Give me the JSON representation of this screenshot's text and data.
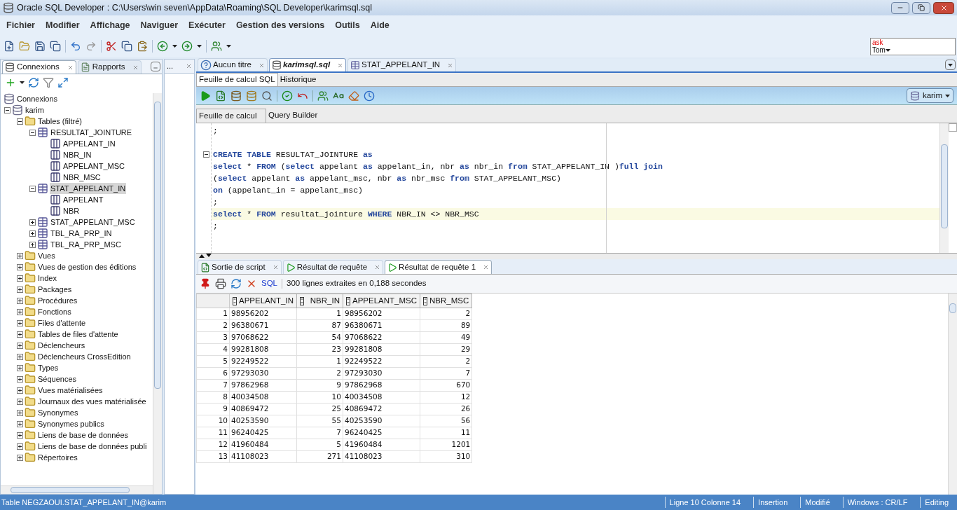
{
  "window": {
    "title": "Oracle SQL Developer : C:\\Users\\win seven\\AppData\\Roaming\\SQL Developer\\karimsql.sql"
  },
  "menu": [
    "Fichier",
    "Modifier",
    "Affichage",
    "Naviguer",
    "Exécuter",
    "Gestion des versions",
    "Outils",
    "Aide"
  ],
  "ask_tom": {
    "line_1": "ask",
    "line_2": "Tom"
  },
  "connections_panel": {
    "tabs": [
      {
        "label": "Connexions",
        "selected": true
      },
      {
        "label": "Rapports",
        "selected": false
      }
    ],
    "tree": [
      {
        "label": "Connexions",
        "kind": "connections",
        "selected": false,
        "children": [
          {
            "label": "karim",
            "kind": "connection",
            "expanded": true,
            "selected": false,
            "children": [
              {
                "label": "Tables (filtré)",
                "kind": "folder",
                "expanded": true,
                "selected": false,
                "children": [
                  {
                    "label": "RESULTAT_JOINTURE",
                    "kind": "table",
                    "expanded": true,
                    "selected": false,
                    "children": [
                      {
                        "label": "APPELANT_IN",
                        "kind": "column",
                        "selected": false
                      },
                      {
                        "label": "NBR_IN",
                        "kind": "column",
                        "selected": false
                      },
                      {
                        "label": "APPELANT_MSC",
                        "kind": "column",
                        "selected": false
                      },
                      {
                        "label": "NBR_MSC",
                        "kind": "column",
                        "selected": false
                      }
                    ]
                  },
                  {
                    "label": "STAT_APPELANT_IN",
                    "kind": "table",
                    "expanded": true,
                    "selected": true,
                    "children": [
                      {
                        "label": "APPELANT",
                        "kind": "column",
                        "selected": false
                      },
                      {
                        "label": "NBR",
                        "kind": "column",
                        "selected": false
                      }
                    ]
                  },
                  {
                    "label": "STAT_APPELANT_MSC",
                    "kind": "table",
                    "expanded": false,
                    "selected": false
                  },
                  {
                    "label": "TBL_RA_PRP_IN",
                    "kind": "table",
                    "expanded": false,
                    "selected": false
                  },
                  {
                    "label": "TBL_RA_PRP_MSC",
                    "kind": "table",
                    "expanded": false,
                    "selected": false
                  }
                ]
              },
              {
                "label": "Vues",
                "kind": "folder",
                "expanded": false,
                "selected": false
              },
              {
                "label": "Vues de gestion des éditions",
                "kind": "folder",
                "expanded": false,
                "selected": false
              },
              {
                "label": "Index",
                "kind": "folder",
                "expanded": false,
                "selected": false
              },
              {
                "label": "Packages",
                "kind": "folder",
                "expanded": false,
                "selected": false
              },
              {
                "label": "Procédures",
                "kind": "folder",
                "expanded": false,
                "selected": false
              },
              {
                "label": "Fonctions",
                "kind": "folder",
                "expanded": false,
                "selected": false
              },
              {
                "label": "Files d'attente",
                "kind": "folder",
                "expanded": false,
                "selected": false
              },
              {
                "label": "Tables de files d'attente",
                "kind": "folder",
                "expanded": false,
                "selected": false
              },
              {
                "label": "Déclencheurs",
                "kind": "folder",
                "expanded": false,
                "selected": false
              },
              {
                "label": "Déclencheurs CrossEdition",
                "kind": "folder",
                "expanded": false,
                "selected": false
              },
              {
                "label": "Types",
                "kind": "folder",
                "expanded": false,
                "selected": false
              },
              {
                "label": "Séquences",
                "kind": "folder",
                "expanded": false,
                "selected": false
              },
              {
                "label": "Vues matérialisées",
                "kind": "folder",
                "expanded": false,
                "selected": false
              },
              {
                "label": "Journaux des vues matérialisée",
                "kind": "folder",
                "expanded": false,
                "selected": false
              },
              {
                "label": "Synonymes",
                "kind": "folder",
                "expanded": false,
                "selected": false
              },
              {
                "label": "Synonymes publics",
                "kind": "folder",
                "expanded": false,
                "selected": false
              },
              {
                "label": "Liens de base de données",
                "kind": "folder",
                "expanded": false,
                "selected": false
              },
              {
                "label": "Liens de base de données publi",
                "kind": "folder",
                "expanded": false,
                "selected": false
              },
              {
                "label": "Répertoires",
                "kind": "folder",
                "expanded": false,
                "selected": false
              }
            ]
          }
        ]
      }
    ]
  },
  "middle_panel": {
    "title": "..."
  },
  "editor_tabs": [
    {
      "label": "Aucun titre",
      "kind": "help",
      "selected": false,
      "modified": false
    },
    {
      "label": "karimsql.sql",
      "kind": "sql",
      "selected": true,
      "modified": true
    },
    {
      "label": "STAT_APPELANT_IN",
      "kind": "table",
      "selected": false,
      "modified": false
    }
  ],
  "worksheet_tabs": [
    {
      "label": "Feuille de calcul SQL",
      "selected": true
    },
    {
      "label": "Historique",
      "selected": false
    }
  ],
  "connection_selector": "karim",
  "editor_subtabs": [
    {
      "label": "Feuille de calcul",
      "selected": true
    },
    {
      "label": "Query Builder",
      "selected": false
    }
  ],
  "code_lines": [
    {
      "current": false,
      "foldable": false,
      "tokens": [
        {
          "text": ";",
          "kind": "plain"
        }
      ]
    },
    {
      "current": false,
      "foldable": false
    },
    {
      "current": false,
      "foldable": true,
      "tokens": [
        {
          "text": "CREATE TABLE",
          "kind": "keyword"
        },
        {
          "text": " RESULTAT_JOINTURE ",
          "kind": "plain"
        },
        {
          "text": "as",
          "kind": "keyword"
        }
      ]
    },
    {
      "current": false,
      "foldable": false,
      "tokens": [
        {
          "text": "select",
          "kind": "keyword"
        },
        {
          "text": " * ",
          "kind": "plain"
        },
        {
          "text": "FROM",
          "kind": "keyword"
        },
        {
          "text": " (",
          "kind": "plain"
        },
        {
          "text": "select",
          "kind": "keyword"
        },
        {
          "text": " appelant ",
          "kind": "plain"
        },
        {
          "text": "as",
          "kind": "keyword"
        },
        {
          "text": " appelant_in, nbr ",
          "kind": "plain"
        },
        {
          "text": "as",
          "kind": "keyword"
        },
        {
          "text": " nbr_in ",
          "kind": "plain"
        },
        {
          "text": "from",
          "kind": "keyword"
        },
        {
          "text": " STAT_APPELANT_IN )",
          "kind": "plain"
        },
        {
          "text": "full join",
          "kind": "keyword"
        }
      ]
    },
    {
      "current": false,
      "foldable": false,
      "tokens": [
        {
          "text": "(",
          "kind": "plain"
        },
        {
          "text": "select",
          "kind": "keyword"
        },
        {
          "text": " appelant ",
          "kind": "plain"
        },
        {
          "text": "as",
          "kind": "keyword"
        },
        {
          "text": " appelant_msc, nbr ",
          "kind": "plain"
        },
        {
          "text": "as",
          "kind": "keyword"
        },
        {
          "text": " nbr_msc ",
          "kind": "plain"
        },
        {
          "text": "from",
          "kind": "keyword"
        },
        {
          "text": " STAT_APPELANT_MSC)",
          "kind": "plain"
        }
      ]
    },
    {
      "current": false,
      "foldable": false,
      "tokens": [
        {
          "text": "on",
          "kind": "keyword"
        },
        {
          "text": " (appelant_in = appelant_msc)",
          "kind": "plain"
        }
      ]
    },
    {
      "current": false,
      "foldable": false,
      "tokens": [
        {
          "text": ";",
          "kind": "plain"
        }
      ]
    },
    {
      "current": true,
      "foldable": false,
      "tokens": [
        {
          "text": "select",
          "kind": "keyword"
        },
        {
          "text": " * ",
          "kind": "plain"
        },
        {
          "text": "FROM",
          "kind": "keyword"
        },
        {
          "text": " resultat_jointure ",
          "kind": "plain"
        },
        {
          "text": "WHERE",
          "kind": "keyword"
        },
        {
          "text": " NBR_IN <> NBR_MSC",
          "kind": "plain"
        }
      ]
    },
    {
      "current": false,
      "foldable": false,
      "tokens": [
        {
          "text": ";",
          "kind": "plain"
        }
      ]
    }
  ],
  "result_tabs": [
    {
      "label": "Sortie de script",
      "kind": "script",
      "selected": false
    },
    {
      "label": "Résultat de requête",
      "kind": "query",
      "selected": false
    },
    {
      "label": "Résultat de requête 1",
      "kind": "query",
      "selected": true
    }
  ],
  "result_toolbar": {
    "sql_link": "SQL",
    "message": "300 lignes extraites en 0,188 secondes"
  },
  "table": {
    "columns": [
      "",
      "APPELANT_IN",
      "NBR_IN",
      "APPELANT_MSC",
      "NBR_MSC"
    ],
    "rows": [
      [
        "1",
        "98956202",
        "1",
        "98956202",
        "2"
      ],
      [
        "2",
        "96380671",
        "87",
        "96380671",
        "89"
      ],
      [
        "3",
        "97068622",
        "54",
        "97068622",
        "49"
      ],
      [
        "4",
        "99281808",
        "23",
        "99281808",
        "29"
      ],
      [
        "5",
        "92249522",
        "1",
        "92249522",
        "2"
      ],
      [
        "6",
        "97293030",
        "2",
        "97293030",
        "7"
      ],
      [
        "7",
        "97862968",
        "9",
        "97862968",
        "670"
      ],
      [
        "8",
        "40034508",
        "10",
        "40034508",
        "12"
      ],
      [
        "9",
        "40869472",
        "25",
        "40869472",
        "26"
      ],
      [
        "10",
        "40253590",
        "55",
        "40253590",
        "56"
      ],
      [
        "11",
        "96240425",
        "7",
        "96240425",
        "11"
      ],
      [
        "12",
        "41960484",
        "5",
        "41960484",
        "1201"
      ],
      [
        "13",
        "41108023",
        "271",
        "41108023",
        "310"
      ]
    ]
  },
  "status_bar": {
    "left": "Table NEGZAOUI.STAT_APPELANT_IN@karim",
    "items": [
      "Ligne 10 Colonne 14",
      "Insertion",
      "Modifié",
      "Windows : CR/LF",
      "Editing"
    ]
  }
}
